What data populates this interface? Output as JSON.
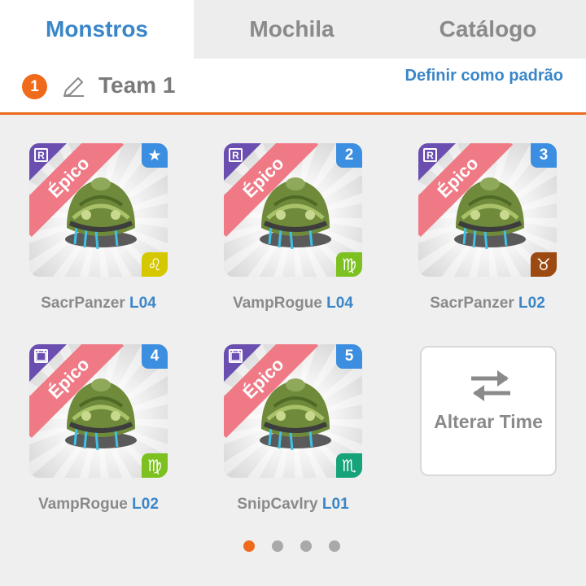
{
  "tabs": [
    {
      "label": "Monstros",
      "active": true
    },
    {
      "label": "Mochila",
      "active": false
    },
    {
      "label": "Catálogo",
      "active": false
    }
  ],
  "team": {
    "badge": "1",
    "name": "Team 1",
    "edit_icon": "pencil-icon",
    "default_link": "Definir como padrão"
  },
  "cards": [
    {
      "name": "SacrPanzer",
      "level": "L04",
      "rarity": "Épico",
      "badge": "R",
      "slot": "★",
      "zodiac": "♌",
      "zodiac_color": "#d6c800"
    },
    {
      "name": "VampRogue",
      "level": "L04",
      "rarity": "Épico",
      "badge": "R",
      "slot": "2",
      "zodiac": "♍",
      "zodiac_color": "#7cc11f"
    },
    {
      "name": "SacrPanzer",
      "level": "L02",
      "rarity": "Épico",
      "badge": "R",
      "slot": "3",
      "zodiac": "♉",
      "zodiac_color": "#9c4a12"
    },
    {
      "name": "VampRogue",
      "level": "L02",
      "rarity": "Épico",
      "badge": "calendar",
      "slot": "4",
      "zodiac": "♍",
      "zodiac_color": "#7cc11f"
    },
    {
      "name": "SnipCavlry",
      "level": "L01",
      "rarity": "Épico",
      "badge": "calendar",
      "slot": "5",
      "zodiac": "♏",
      "zodiac_color": "#17a37a"
    }
  ],
  "swap": {
    "label": "Alterar Time",
    "icon": "swap-arrows-icon"
  },
  "pagination": {
    "pages": 4,
    "current": 1
  },
  "colors": {
    "accent": "#f06a1c",
    "link": "#3a86c8",
    "ribbon": "#ef7a86",
    "corner_purple": "#6b4fb0",
    "slot_blue": "#3c8fe0"
  }
}
